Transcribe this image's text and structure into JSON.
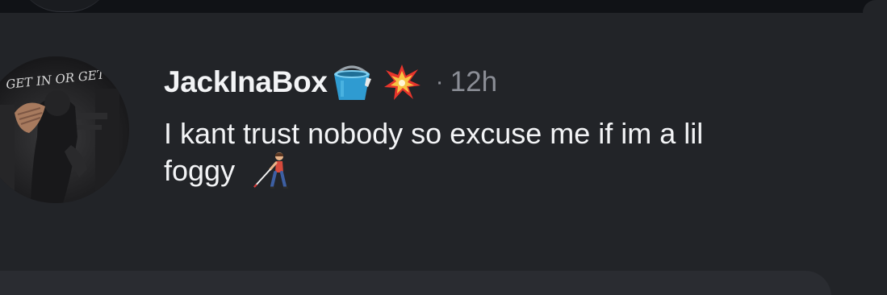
{
  "post": {
    "username": "JackInaBox",
    "username_emojis": [
      "bucket-icon",
      "collision-icon"
    ],
    "separator": "·",
    "timestamp": "12h",
    "body_line1": "I kant trust nobody so excuse me if im a lil",
    "body_line2": "foggy",
    "body_emoji": "person-with-white-cane-icon",
    "avatar_text": "GET IN OR GET OUT"
  },
  "colors": {
    "background": "#222428",
    "text_primary": "#f3f4f6",
    "text_secondary": "#8b8e96",
    "top_strip": "#101216"
  }
}
